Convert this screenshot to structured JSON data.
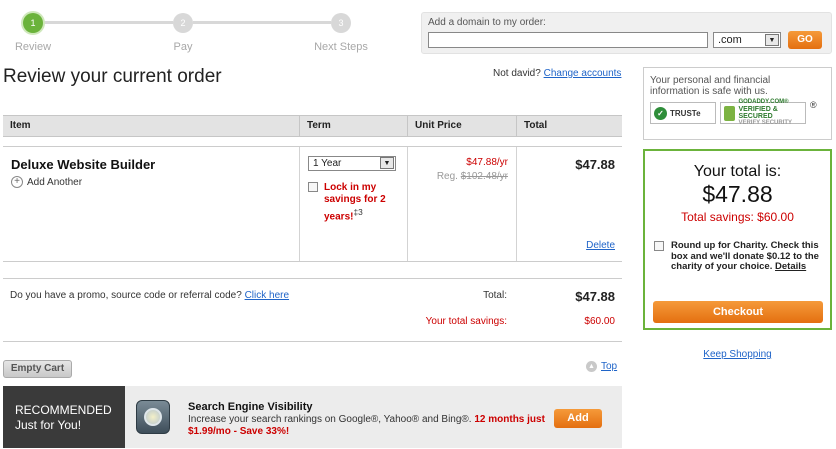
{
  "steps": [
    {
      "number": "1",
      "label": "Review"
    },
    {
      "number": "2",
      "label": "Pay"
    },
    {
      "number": "3",
      "label": "Next Steps"
    }
  ],
  "domain": {
    "label": "Add a domain to my order:",
    "input_value": "",
    "tld_selected": ".com",
    "go_label": "GO"
  },
  "page_title": "Review your current order",
  "account": {
    "prefix": "Not david?",
    "link": "Change accounts"
  },
  "table": {
    "headers": [
      "Item",
      "Term",
      "Unit Price",
      "Total"
    ],
    "product": {
      "name": "Deluxe Website Builder",
      "add_another": "Add Another",
      "term_selected": "1 Year",
      "lock_text": "Lock in my savings for 2 years!",
      "lock_footnote": "‡3",
      "unit_price": "$47.88/yr",
      "reg_label": "Reg.",
      "reg_price": "$102.48/yr",
      "total": "$47.88",
      "delete_label": "Delete"
    }
  },
  "promo": {
    "text": "Do you have a promo, source code or referral code?",
    "link": "Click here"
  },
  "summary": {
    "total_label": "Total:",
    "total_value": "$47.88",
    "savings_label": "Your total savings:",
    "savings_value": "$60.00"
  },
  "empty_cart_label": "Empty Cart",
  "top_label": "Top",
  "recommended": {
    "label_line1": "RECOMMENDED",
    "label_line2": "Just for You!",
    "title": "Search Engine Visibility",
    "desc": "Increase your search rankings on Google®, Yahoo® and Bing®.",
    "promo": "12 months just $1.99/mo - Save 33%!",
    "add_label": "Add"
  },
  "security": {
    "text": "Your personal and financial information is safe with us.",
    "truste_label": "TRUSTe",
    "verified_line1": "GODADDY.COM®",
    "verified_line2": "VERIFIED & SECURED",
    "verified_line3": "VERIFY SECURITY",
    "reg_mark": "®"
  },
  "order_total": {
    "heading": "Your total is:",
    "amount": "$47.88",
    "savings_label": "Total savings:",
    "savings_value": "$60.00",
    "charity_text": "Round up for Charity. Check this box and we'll donate $0.12 to the charity of your choice.",
    "details_link": "Details",
    "checkout_label": "Checkout"
  },
  "keep_shopping": "Keep Shopping",
  "colors": {
    "accent_green": "#6bb33b",
    "button_orange": "#e46f10",
    "savings_red": "#cc0000",
    "link_blue": "#1f64c8"
  }
}
